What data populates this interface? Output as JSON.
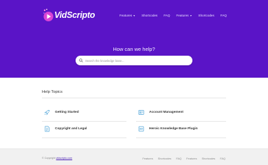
{
  "brand": {
    "name": "VidScripto"
  },
  "nav": {
    "items": [
      {
        "label": "Features",
        "dropdown": true
      },
      {
        "label": "Shortcodes",
        "dropdown": false
      },
      {
        "label": "FAQ",
        "dropdown": false
      },
      {
        "label": "Features",
        "dropdown": true
      },
      {
        "label": "Shortcodes",
        "dropdown": false
      },
      {
        "label": "FAQ",
        "dropdown": false
      }
    ]
  },
  "hero": {
    "title": "How can we help?",
    "search_placeholder": "Search the knowledge base..."
  },
  "topics": {
    "heading": "Help Topics",
    "items": [
      {
        "label": "Getting Started",
        "icon": "rocket-icon"
      },
      {
        "label": "Account Management",
        "icon": "account-icon"
      },
      {
        "label": "Copyright and Legal",
        "icon": "document-icon"
      },
      {
        "label": "Heroic Knowledge Base Plugin",
        "icon": "plugin-icon"
      }
    ]
  },
  "footer": {
    "copyright_prefix": "© Copyright",
    "copyright_link": "vidscripto.com",
    "links": [
      "Features",
      "Shortcodes",
      "FAQ",
      "Features",
      "Shortcodes",
      "FAQ"
    ]
  },
  "colors": {
    "hero_bg": "#5a14c7",
    "accent": "#5a14c7",
    "icon_blue": "#4fa4d8",
    "footer_bg": "#f1f1f1"
  }
}
